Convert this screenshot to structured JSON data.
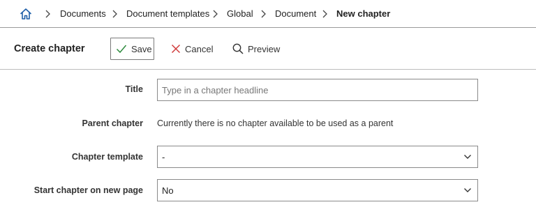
{
  "breadcrumb": {
    "home_icon": "home-icon",
    "items": [
      "Documents",
      "Document templates",
      "Global",
      "Document",
      "New chapter"
    ]
  },
  "toolbar": {
    "title": "Create chapter",
    "save_label": "Save",
    "cancel_label": "Cancel",
    "preview_label": "Preview"
  },
  "form": {
    "title": {
      "label": "Title",
      "value": "",
      "placeholder": "Type in a chapter headline"
    },
    "parent_chapter": {
      "label": "Parent chapter",
      "text": "Currently there is no chapter available to be used as a parent"
    },
    "chapter_template": {
      "label": "Chapter template",
      "value": "-"
    },
    "start_new_page": {
      "label": "Start chapter on new page",
      "value": "No"
    }
  },
  "colors": {
    "home_icon": "#1f5fa8",
    "save_check": "#2e8b3e",
    "cancel_x": "#d03a3a",
    "border": "#8a8a8a"
  }
}
